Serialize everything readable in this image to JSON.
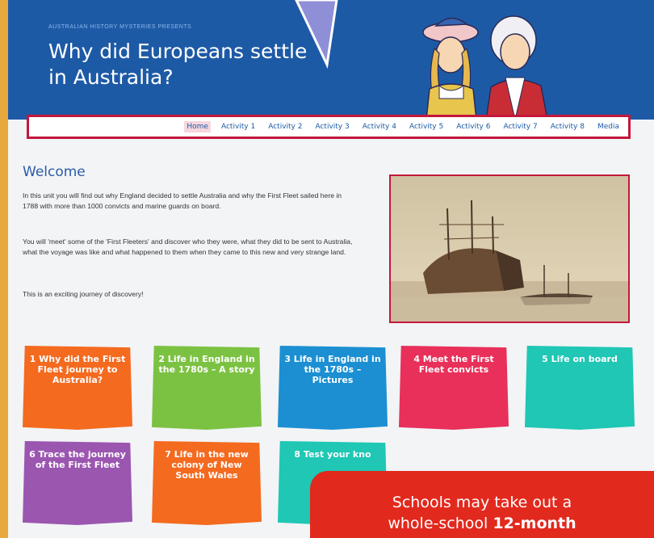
{
  "header": {
    "kicker": "AUSTRALIAN HISTORY MYSTERIES PRESENTS",
    "title": "Why did Europeans settle in Australia?"
  },
  "nav": {
    "items": [
      {
        "label": "Home"
      },
      {
        "label": "Activity 1"
      },
      {
        "label": "Activity 2"
      },
      {
        "label": "Activity 3"
      },
      {
        "label": "Activity 4"
      },
      {
        "label": "Activity 5"
      },
      {
        "label": "Activity 6"
      },
      {
        "label": "Activity 7"
      },
      {
        "label": "Activity 8"
      },
      {
        "label": "Media"
      }
    ],
    "active": "Home"
  },
  "welcome": {
    "title": "Welcome",
    "paragraphs": [
      "In this unit you will find out why England decided to settle Australia and why the First Fleet sailed here in 1788 with more than 1000 convicts and marine guards on board.",
      "You will 'meet' some of the 'First Fleeters' and discover who they were, what they did to be sent to Australia, what the voyage was like and what happened to them when they came to this new and very strange land.",
      "This is an exciting journey of discovery!"
    ]
  },
  "tiles": [
    {
      "label": "1 Why did the First Fleet journey to Australia?"
    },
    {
      "label": "2 Life in England in the 1780s – A story"
    },
    {
      "label": "3 Life in England in the 1780s – Pictures"
    },
    {
      "label": "4 Meet the First Fleet convicts"
    },
    {
      "label": "5 Life on board"
    },
    {
      "label": "6 Trace the journey of the First Fleet"
    },
    {
      "label": "7 Life in the new colony of New South Wales"
    },
    {
      "label": "8 Test your kno"
    }
  ],
  "callout": {
    "line1": "Schools may take out a",
    "line2_prefix": "whole-school ",
    "line2_bold": "12-month"
  },
  "colors": {
    "header_blue": "#1d5aa6",
    "nav_border": "#c4173c",
    "background_orange": "#e8a93c",
    "callout_red": "#e2291d"
  }
}
